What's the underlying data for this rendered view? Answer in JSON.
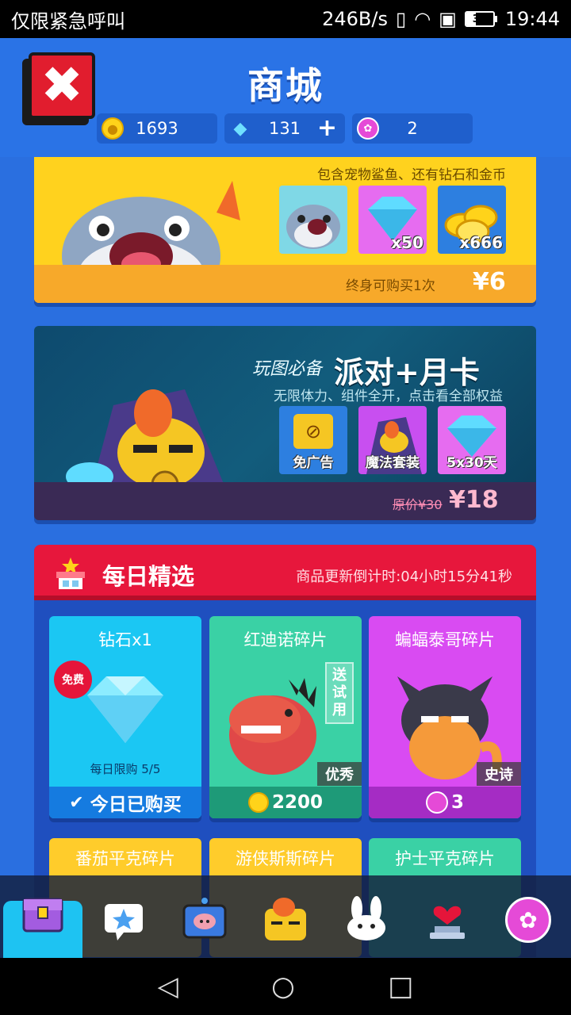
{
  "statusbar": {
    "carrier": "仅限紧急呼叫",
    "speed": "246B/s",
    "battery": "35",
    "battery_level": 0.35,
    "time": "19:44"
  },
  "header": {
    "title": "商城",
    "close_icon": "close-icon",
    "currencies": {
      "gold": "1693",
      "gems": "131",
      "gem_plus": "+",
      "lotus": "2"
    }
  },
  "banner_pet": {
    "subtitle": "包含宠物鲨鱼、还有钻石和金币",
    "tiles": [
      "",
      "x50",
      "x666"
    ],
    "limit": "终身可购买1次",
    "price": "¥6"
  },
  "banner_party": {
    "tagline": "玩图必备",
    "title": "派对+月卡",
    "subtitle": "无限体力、组件全开，点击看全部权益",
    "tiles": [
      "免广告",
      "魔法套装",
      "5x30天"
    ],
    "original_price": "原价¥30",
    "price": "¥18"
  },
  "daily": {
    "title": "每日精选",
    "timer": "商品更新倒计时:04小时15分41秒",
    "cards": [
      {
        "name": "钻石x1",
        "badge": "免费",
        "limit": "每日限购 5/5",
        "bar": "今日已购买",
        "check": "✔"
      },
      {
        "name": "红迪诺碎片",
        "trial": "送试用",
        "rarity": "优秀",
        "price": "2200"
      },
      {
        "name": "蝙蝠泰哥碎片",
        "rarity": "史诗",
        "price": "3"
      }
    ],
    "row2": [
      {
        "name": "番茄平克碎片"
      },
      {
        "name": "游侠斯斯碎片"
      },
      {
        "name": "护士平克碎片"
      }
    ]
  },
  "sysnav": {
    "back": "◁",
    "home": "○",
    "recent": "□"
  },
  "colors": {
    "accent": "#2a6fe0",
    "daily_red": "#e7173c",
    "banner_yellow": "#ffd21e"
  }
}
